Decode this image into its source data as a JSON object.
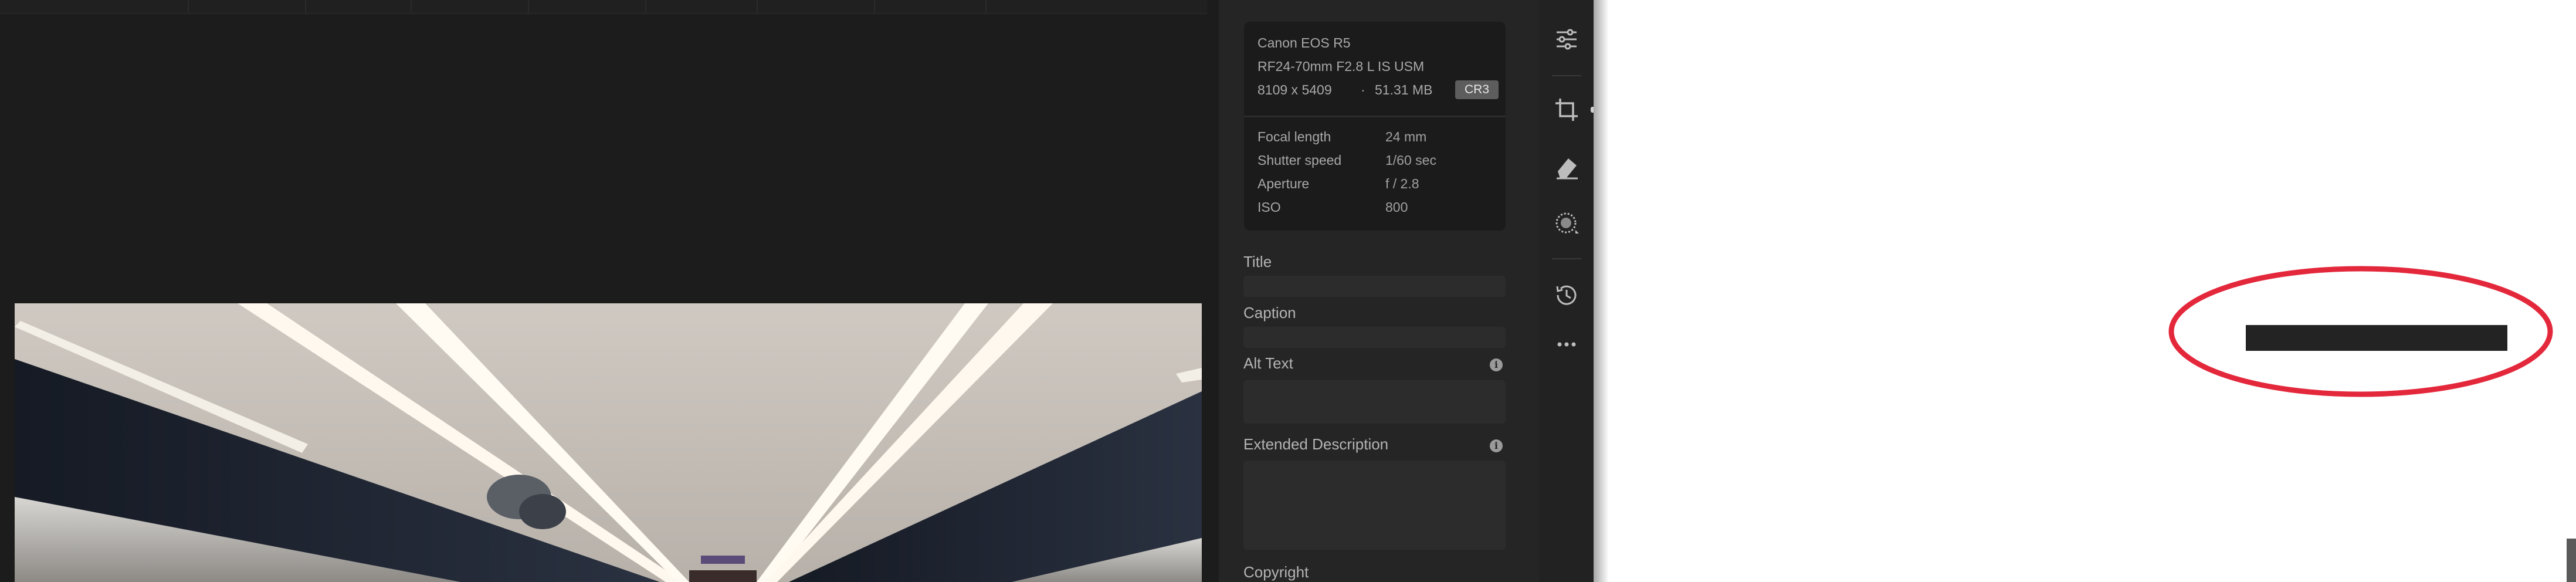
{
  "camera_info": {
    "camera": "Canon EOS R5",
    "lens": "RF24-70mm F2.8 L IS USM",
    "dimensions": "8109 x 5409",
    "separator": "·",
    "file_size": "51.31 MB",
    "file_type": "CR3"
  },
  "exif": [
    {
      "label": "Focal length",
      "value": "24 mm"
    },
    {
      "label": "Shutter speed",
      "value": "1/60 sec"
    },
    {
      "label": "Aperture",
      "value": "f / 2.8"
    },
    {
      "label": "ISO",
      "value": "800"
    }
  ],
  "fields": {
    "title_label": "Title",
    "title_value": "",
    "caption_label": "Caption",
    "caption_value": "",
    "alt_text_label": "Alt Text",
    "alt_text_value": "",
    "extended_description_label": "Extended Description",
    "extended_description_value": "",
    "copyright_label": "Copyright"
  },
  "rail_icons": [
    "sliders-icon",
    "crop-icon",
    "eraser-icon",
    "masking-icon",
    "history-icon",
    "more-icon"
  ],
  "colors": {
    "annotation_red": "#e4283c",
    "panel_bg": "#252525",
    "app_bg": "#1c1c1c"
  }
}
